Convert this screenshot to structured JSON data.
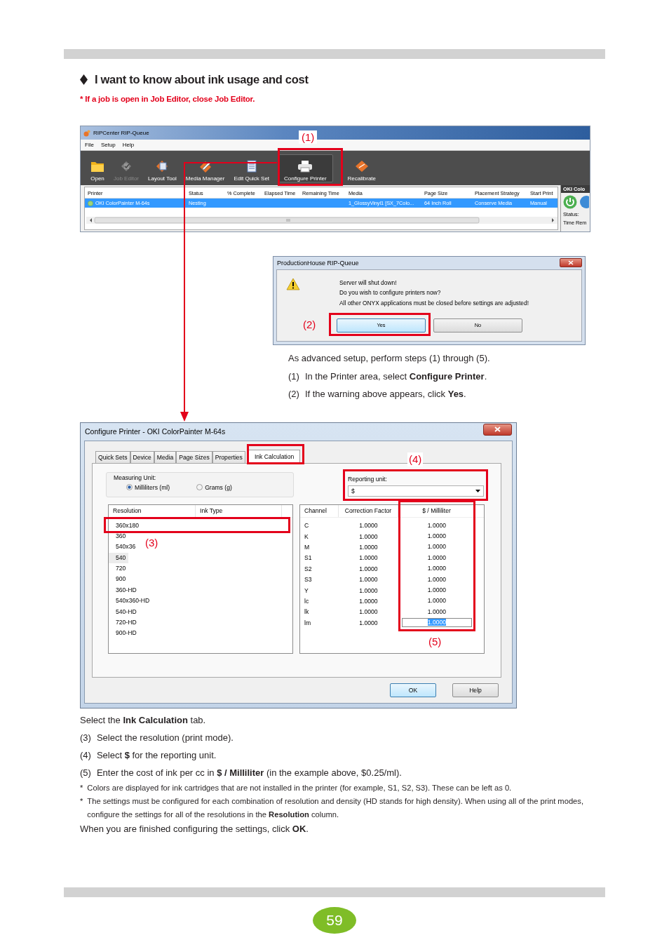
{
  "page_title": "I want to know about ink usage and cost",
  "caution": "* If a job is open in Job Editor, close Job Editor.",
  "rip_queue": {
    "title": "RIPCenter RIP-Queue",
    "menu": [
      "File",
      "Setup",
      "Help"
    ],
    "toolbar": [
      {
        "label": "Open",
        "disabled": false,
        "highlighted": false
      },
      {
        "label": "Job Editor",
        "disabled": true,
        "highlighted": false
      },
      {
        "label": "Layout Tool",
        "disabled": false,
        "highlighted": false
      },
      {
        "label": "Media Manager",
        "disabled": false,
        "highlighted": false
      },
      {
        "label": "Edit Quick Set",
        "disabled": false,
        "highlighted": false
      },
      {
        "label": "Configure Printer",
        "disabled": false,
        "highlighted": true
      },
      {
        "label": "Recalibrate",
        "disabled": false,
        "highlighted": false
      }
    ],
    "columns": [
      "Printer",
      "Status",
      "% Complete",
      "Elapsed Time",
      "Remaining Time",
      "Media",
      "Page Size",
      "Placement Strategy",
      "Start Print"
    ],
    "rows": [
      {
        "printer": "OKI ColorPainter M-64s",
        "status": "Nesting",
        "media": "1_GlossyVinyl1 [SX_7Colo...",
        "page_size": "64 Inch Roll",
        "placement_strategy": "Conserve Media",
        "start_print": "Manual",
        "selected": true
      }
    ],
    "side_panel": {
      "header": "OKI Colo",
      "status_label": "Status:",
      "time_label": "Time Rem"
    },
    "callout": "(1)"
  },
  "dialog": {
    "title": "ProductionHouse RIP-Queue",
    "message": [
      "Server will shut down!",
      "Do you wish to configure printers now?",
      "All other ONYX applications must be closed before settings are adjusted!"
    ],
    "buttons": [
      {
        "label": "Yes",
        "default": true
      },
      {
        "label": "No",
        "default": false
      }
    ],
    "callout": "(2)"
  },
  "steps_intro": "As advanced setup, perform steps (1) through (5).",
  "steps_a": [
    {
      "number": "(1)",
      "text": "In the Printer area, select **Configure Printer**."
    },
    {
      "number": "(2)",
      "text": "If the warning above appears, click **Yes**."
    }
  ],
  "configure_printer": {
    "title": "Configure Printer - OKI ColorPainter M-64s",
    "tabs": [
      {
        "label": "Quick Sets",
        "selected": false
      },
      {
        "label": "Device",
        "selected": false
      },
      {
        "label": "Media",
        "selected": false
      },
      {
        "label": "Page Sizes",
        "selected": false
      },
      {
        "label": "Properties",
        "selected": false
      },
      {
        "label": "Ink Calculation",
        "selected": true
      }
    ],
    "measuring_unit": {
      "label": "Measuring Unit:",
      "options": [
        {
          "label": "Milliliters (ml)",
          "selected": true
        },
        {
          "label": "Grams (g)",
          "selected": false
        }
      ]
    },
    "reporting_unit": {
      "label": "Reporting unit:",
      "value": "$"
    },
    "resolution_columns": [
      "Resolution",
      "Ink Type"
    ],
    "resolutions": [
      {
        "name": "360x180",
        "highlighted": false
      },
      {
        "name": "360",
        "highlighted": false
      },
      {
        "name": "540x36",
        "highlighted": false
      },
      {
        "name": "540",
        "highlighted": true
      },
      {
        "name": "720",
        "highlighted": false
      },
      {
        "name": "900",
        "highlighted": false
      },
      {
        "name": "360-HD",
        "highlighted": false
      },
      {
        "name": "540x360-HD",
        "highlighted": false
      },
      {
        "name": "540-HD",
        "highlighted": false
      },
      {
        "name": "720-HD",
        "highlighted": false
      },
      {
        "name": "900-HD",
        "highlighted": false
      }
    ],
    "ink_columns": [
      "Channel",
      "Correction Factor",
      "$ / Milliliter"
    ],
    "channels": [
      {
        "channel": "C",
        "correction_factor": "1.0000",
        "cost": "1.0000",
        "editing": false
      },
      {
        "channel": "K",
        "correction_factor": "1.0000",
        "cost": "1.0000",
        "editing": false
      },
      {
        "channel": "M",
        "correction_factor": "1.0000",
        "cost": "1.0000",
        "editing": false
      },
      {
        "channel": "S1",
        "correction_factor": "1.0000",
        "cost": "1.0000",
        "editing": false
      },
      {
        "channel": "S2",
        "correction_factor": "1.0000",
        "cost": "1.0000",
        "editing": false
      },
      {
        "channel": "S3",
        "correction_factor": "1.0000",
        "cost": "1.0000",
        "editing": false
      },
      {
        "channel": "Y",
        "correction_factor": "1.0000",
        "cost": "1.0000",
        "editing": false
      },
      {
        "channel": "lc",
        "correction_factor": "1.0000",
        "cost": "1.0000",
        "editing": false
      },
      {
        "channel": "lk",
        "correction_factor": "1.0000",
        "cost": "1.0000",
        "editing": false
      },
      {
        "channel": "lm",
        "correction_factor": "1.0000",
        "cost": "1.0000",
        "editing": true
      }
    ],
    "buttons": [
      {
        "label": "OK",
        "default": true
      },
      {
        "label": "Help",
        "default": false
      }
    ],
    "callouts": [
      "(3)",
      "(4)",
      "(5)"
    ]
  },
  "tab_instruction": "Select the **Ink Calculation** tab.",
  "steps_b": [
    {
      "number": "(3)",
      "text": "Select the resolution (print mode)."
    },
    {
      "number": "(4)",
      "text": "Select **$** for the reporting unit."
    },
    {
      "number": "(5)",
      "text": "Enter the cost of ink per cc in **$ / Milliliter** (in the example above, $0.25/ml)."
    }
  ],
  "footnotes": [
    {
      "mark": "*",
      "text": "Colors are displayed for ink cartridges that are not installed in the printer (for example, S1, S2, S3). These can be left as 0."
    },
    {
      "mark": "*",
      "text": "The settings must be configured for each combination of resolution and density (HD stands for high density). When using all of the print modes, configure the settings for all of the resolutions in the **Resolution** column."
    }
  ],
  "closing": "When you are finished configuring the settings, click **OK**.",
  "page_number": "59"
}
